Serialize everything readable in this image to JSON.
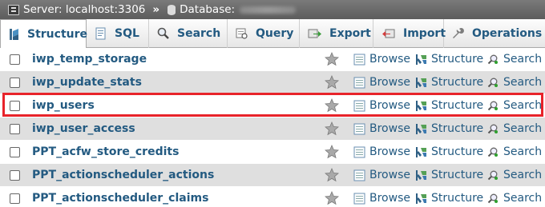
{
  "breadcrumb": {
    "server_label": "Server: localhost:3306",
    "separator": "»",
    "database_label": "Database:"
  },
  "tabs": [
    {
      "label": "Structure",
      "icon": "structure-icon",
      "active": true
    },
    {
      "label": "SQL",
      "icon": "sql-icon",
      "active": false
    },
    {
      "label": "Search",
      "icon": "search-icon",
      "active": false
    },
    {
      "label": "Query",
      "icon": "query-icon",
      "active": false
    },
    {
      "label": "Export",
      "icon": "export-icon",
      "active": false
    },
    {
      "label": "Import",
      "icon": "import-icon",
      "active": false
    },
    {
      "label": "Operations",
      "icon": "wrench-icon",
      "active": false
    }
  ],
  "actions": {
    "browse": "Browse",
    "structure": "Structure",
    "search": "Search"
  },
  "tables": [
    {
      "name": "iwp_temp_storage"
    },
    {
      "name": "iwp_update_stats"
    },
    {
      "name": "iwp_users",
      "highlighted": true
    },
    {
      "name": "iwp_user_access"
    },
    {
      "name": "PPT_acfw_store_credits"
    },
    {
      "name": "PPT_actionscheduler_actions"
    },
    {
      "name": "PPT_actionscheduler_claims"
    }
  ],
  "colors": {
    "link": "#235a81",
    "highlight_border": "#e8232a",
    "row_alt": "#dfdfdf"
  }
}
